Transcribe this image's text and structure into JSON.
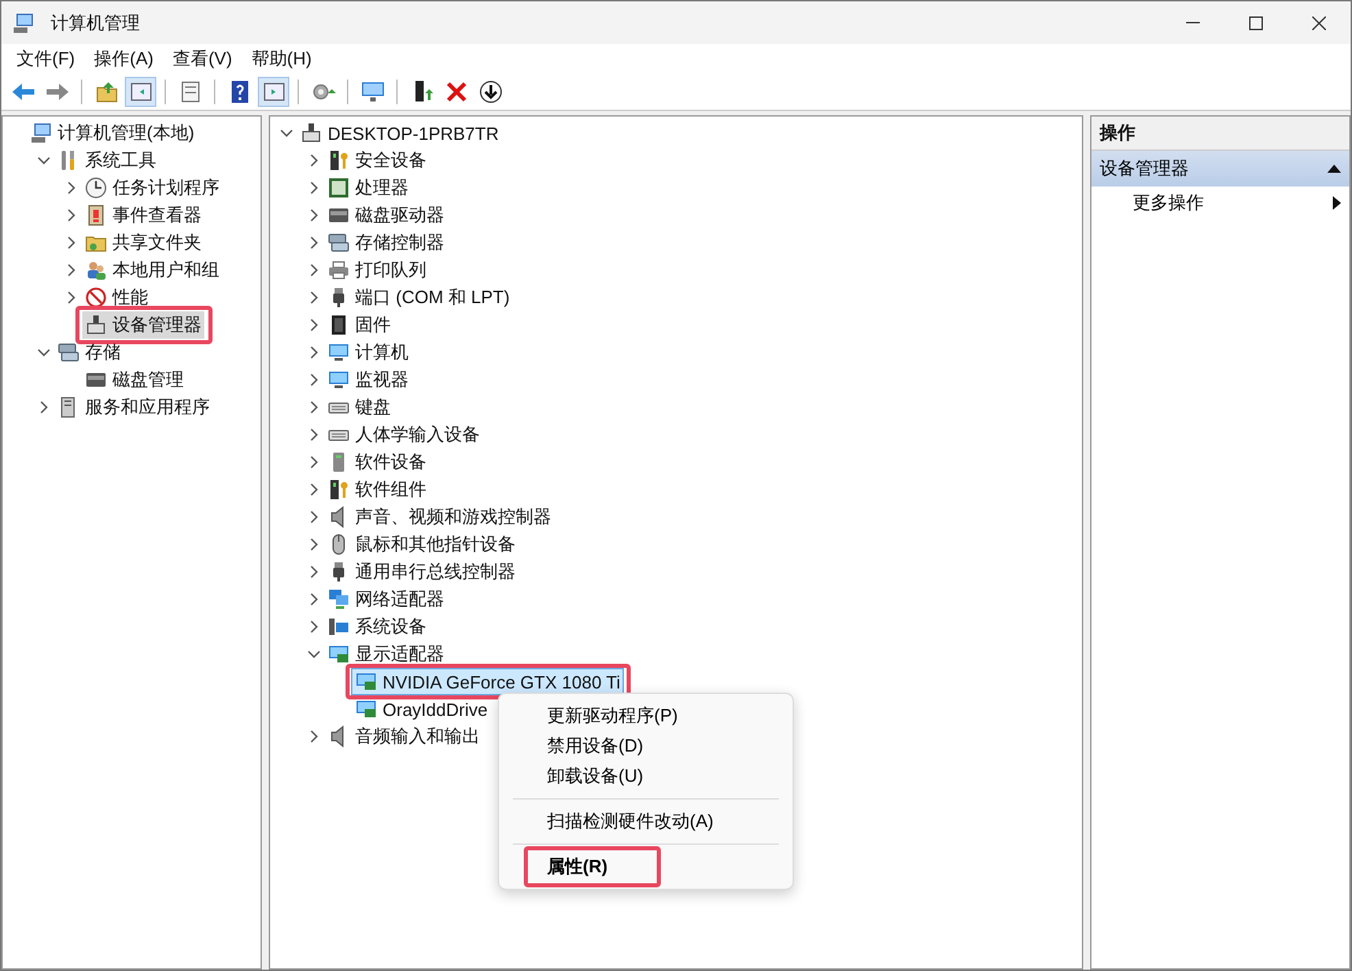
{
  "window": {
    "title": "计算机管理"
  },
  "menu_bar": [
    "文件(F)",
    "操作(A)",
    "查看(V)",
    "帮助(H)"
  ],
  "toolbar": [
    {
      "kind": "button",
      "pressed": false
    },
    {
      "kind": "button",
      "pressed": false
    },
    {
      "kind": "separator"
    },
    {
      "kind": "button",
      "pressed": false
    },
    {
      "kind": "button",
      "pressed": true
    },
    {
      "kind": "separator"
    },
    {
      "kind": "button",
      "pressed": false
    },
    {
      "kind": "separator"
    },
    {
      "kind": "button",
      "pressed": false
    },
    {
      "kind": "button",
      "pressed": true
    },
    {
      "kind": "separator"
    },
    {
      "kind": "button",
      "pressed": false
    },
    {
      "kind": "separator"
    },
    {
      "kind": "button",
      "pressed": false
    },
    {
      "kind": "separator"
    },
    {
      "kind": "button",
      "pressed": false
    },
    {
      "kind": "button",
      "pressed": false
    },
    {
      "kind": "button",
      "pressed": false
    }
  ],
  "left_tree": [
    {
      "label": "计算机管理(本地)",
      "selected": false,
      "highlighted": false,
      "children": [
        {
          "label": "系统工具",
          "expanded": true,
          "selected": false,
          "highlighted": false,
          "children": [
            {
              "label": "任务计划程序",
              "expanded": false,
              "selected": false,
              "highlighted": false
            },
            {
              "label": "事件查看器",
              "expanded": false,
              "selected": false,
              "highlighted": false
            },
            {
              "label": "共享文件夹",
              "expanded": false,
              "selected": false,
              "highlighted": false
            },
            {
              "label": "本地用户和组",
              "expanded": false,
              "selected": false,
              "highlighted": false
            },
            {
              "label": "性能",
              "expanded": false,
              "selected": false,
              "highlighted": false
            },
            {
              "label": "设备管理器",
              "selected": true,
              "highlighted": true
            }
          ]
        },
        {
          "label": "存储",
          "expanded": true,
          "selected": false,
          "highlighted": false,
          "children": [
            {
              "label": "磁盘管理",
              "selected": false,
              "highlighted": false
            }
          ]
        },
        {
          "label": "服务和应用程序",
          "expanded": false,
          "selected": false,
          "highlighted": false
        }
      ]
    }
  ],
  "device_tree": [
    {
      "label": "DESKTOP-1PRB7TR",
      "expanded": true,
      "selected": false,
      "highlighted": false,
      "children": [
        {
          "label": "安全设备",
          "expanded": false,
          "selected": false,
          "highlighted": false
        },
        {
          "label": "处理器",
          "expanded": false,
          "selected": false,
          "highlighted": false
        },
        {
          "label": "磁盘驱动器",
          "expanded": false,
          "selected": false,
          "highlighted": false
        },
        {
          "label": "存储控制器",
          "expanded": false,
          "selected": false,
          "highlighted": false
        },
        {
          "label": "打印队列",
          "expanded": false,
          "selected": false,
          "highlighted": false
        },
        {
          "label": "端口 (COM 和 LPT)",
          "expanded": false,
          "selected": false,
          "highlighted": false
        },
        {
          "label": "固件",
          "expanded": false,
          "selected": false,
          "highlighted": false
        },
        {
          "label": "计算机",
          "expanded": false,
          "selected": false,
          "highlighted": false
        },
        {
          "label": "监视器",
          "expanded": false,
          "selected": false,
          "highlighted": false
        },
        {
          "label": "键盘",
          "expanded": false,
          "selected": false,
          "highlighted": false
        },
        {
          "label": "人体学输入设备",
          "expanded": false,
          "selected": false,
          "highlighted": false
        },
        {
          "label": "软件设备",
          "expanded": false,
          "selected": false,
          "highlighted": false
        },
        {
          "label": "软件组件",
          "expanded": false,
          "selected": false,
          "highlighted": false
        },
        {
          "label": "声音、视频和游戏控制器",
          "expanded": false,
          "selected": false,
          "highlighted": false
        },
        {
          "label": "鼠标和其他指针设备",
          "expanded": false,
          "selected": false,
          "highlighted": false
        },
        {
          "label": "通用串行总线控制器",
          "expanded": false,
          "selected": false,
          "highlighted": false
        },
        {
          "label": "网络适配器",
          "expanded": false,
          "selected": false,
          "highlighted": false
        },
        {
          "label": "系统设备",
          "expanded": false,
          "selected": false,
          "highlighted": false
        },
        {
          "label": "显示适配器",
          "expanded": true,
          "selected": false,
          "highlighted": false,
          "children": [
            {
              "label": "NVIDIA GeForce GTX 1080 Ti",
              "selected": true,
              "highlighted": true
            },
            {
              "label": "OrayIddDrive",
              "selected": false,
              "highlighted": false
            }
          ]
        },
        {
          "label": "音频输入和输出",
          "expanded": false,
          "selected": false,
          "highlighted": false
        }
      ]
    }
  ],
  "context_menu": [
    {
      "kind": "item",
      "label": "更新驱动程序(P)",
      "default": false,
      "highlighted": false
    },
    {
      "kind": "item",
      "label": "禁用设备(D)",
      "default": false,
      "highlighted": false
    },
    {
      "kind": "item",
      "label": "卸载设备(U)",
      "default": false,
      "highlighted": false
    },
    {
      "kind": "separator"
    },
    {
      "kind": "item",
      "label": "扫描检测硬件改动(A)",
      "default": false,
      "highlighted": false
    },
    {
      "kind": "separator"
    },
    {
      "kind": "item",
      "label": "属性(R)",
      "default": true,
      "highlighted": true
    }
  ],
  "actions": {
    "header": "操作",
    "section": {
      "label": "设备管理器",
      "expanded": true
    },
    "items": [
      {
        "label": "更多操作"
      }
    ]
  }
}
